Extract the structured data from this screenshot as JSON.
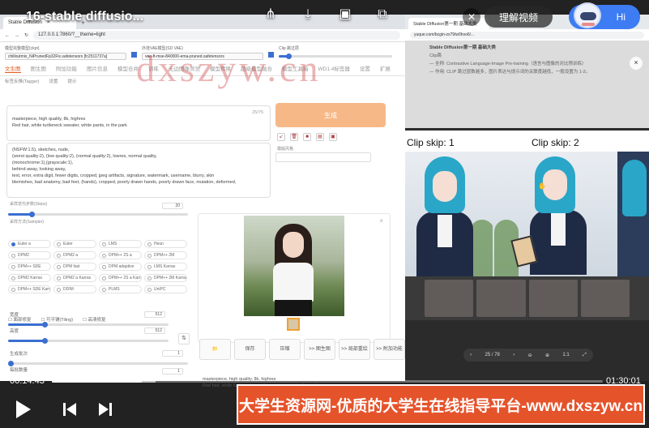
{
  "video": {
    "title": "16-stable diffusio...",
    "understand_label": "理解视频",
    "assistant_greeting": "Hi",
    "time_current": "00:14:43",
    "time_total": "01:30:01",
    "progress_fraction": 0.163
  },
  "watermark": "dxszyw.cn",
  "banner": "大学生资源网-优质的大学生在线指导平台-www.dxszyw.cn",
  "left_browser": {
    "tab_title": "Stable Diffusion",
    "url": "127.0.0.1:7860/?__theme=light",
    "top_fields": {
      "model_label": "模型完整模型(ckpt)",
      "model_value": "chilloutmix_NiPrunedFp32Fix.safetensors [fc2511737a]",
      "vae_label": "外挂VAE模型(SD VAE)",
      "vae_value": "vae-ft-mse-840000-ema-pruned.safetensors",
      "clip_label": "Clip 跳过层"
    },
    "tabs": [
      "文生图",
      "图生图",
      "附加功能",
      "图片信息",
      "模型合并",
      "训练",
      "无边图像浏览",
      "模型转换",
      "超级模型融合",
      "模型工具箱",
      "WD1.4标签器",
      "设置",
      "扩展"
    ],
    "active_tab": "文生图",
    "sub_tabs": [
      "标签反推(Tagger)",
      "设置",
      "提示"
    ],
    "prompt_counter": "25/75",
    "positive_prompt": "masterpiece, high quality, 8k, highres\nRed hair, white turtleneck sweater, white pants, in the park",
    "negative_prompt": "(NSFW:1.5), sketches, nude,\n(worst quality:2), (low quality:2), (normal quality:2), lowres, normal quality,\n(monochrome:1),(grayscale:1),\nbehind away, looking away,\ntext, error, extra digit, fewer digits, cropped, jpeg artifacts, signature, watermark, username, blurry, skin\nblemishes, bad anatomy, bad feet, (hands), cropped, poorly drawn hands, poorly drawn face, mutation, deformed,",
    "generate_label": "生成",
    "style_label": "模版风格",
    "steps_label": "采样迭代步数(Steps)",
    "steps_value": "20",
    "sampler_label": "采样方法(Sampler)",
    "samplers": [
      "Euler a",
      "Euler",
      "LMS",
      "Heun",
      "DPM2",
      "DPM2 a",
      "DPM++ 2S a",
      "DPM++ 2M",
      "DPM++ SDE",
      "DPM fast",
      "DPM adaptive",
      "LMS Karras",
      "DPM2 Karras",
      "DPM2 a Karras",
      "DPM++ 2S a Karras",
      "DPM++ 2M Karras",
      "DPM++ SDE Karras",
      "DDIM",
      "PLMS",
      "UniPC"
    ],
    "selected_sampler": "Euler a",
    "options": [
      "面部修复",
      "可平铺(Tiling)",
      "高清修复"
    ],
    "width_label": "宽度",
    "width_value": "512",
    "height_label": "高度",
    "height_value": "512",
    "batch_count_label": "生成批次",
    "batch_count_value": "1",
    "batch_size_label": "每批数量",
    "batch_size_value": "1",
    "actions": [
      "📁",
      "保存",
      "压缩",
      ">> 图生图",
      ">> 局部重绘",
      ">> 附加功能"
    ],
    "output_prompt": "masterpiece, high quality, 8k, highres\nRed hair, white turtleneck sweater, white pants, in the park"
  },
  "right_browser": {
    "tab_title": "Stable Diffusion第一期 基础大类",
    "url": "yuque.com/bcgin-zx79/w0hvo6/...",
    "doc_title": "Stable Diffusion第一期 基础大类",
    "doc_line1": "Clip跳",
    "doc_line2": "— 全称: Contrastive Language-Image Pre-training（语言与图像的对比预训练）",
    "doc_line3": "— 作用: CLIP 跳过层数越多，图片表达与提示词的关联度越低，一般设置为 1-2。",
    "clip_labels": [
      "Clip skip: 1",
      "Clip skip: 2"
    ],
    "pager": "25 / 78",
    "zoom": "1:1"
  }
}
